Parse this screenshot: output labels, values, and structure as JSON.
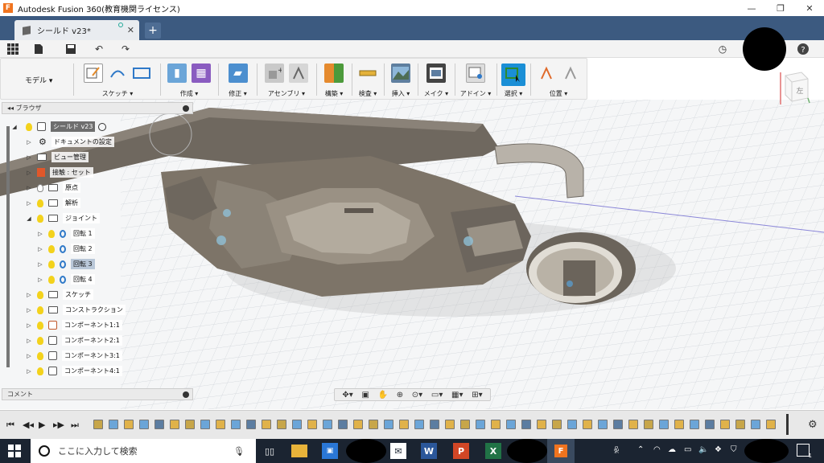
{
  "window": {
    "app_logo_letter": "F",
    "title": "Autodesk Fusion 360(教育機関ライセンス)",
    "minimize": "—",
    "maximize": "❐",
    "close": "✕"
  },
  "tabs": {
    "doc_tab_label": "シールド v23*",
    "close": "✕",
    "new": "+"
  },
  "ribbon": {
    "workspace": "モデル ▾",
    "groups": [
      {
        "label": "スケッチ ▾"
      },
      {
        "label": "作成 ▾"
      },
      {
        "label": "修正 ▾"
      },
      {
        "label": "アセンブリ ▾"
      },
      {
        "label": "構築 ▾"
      },
      {
        "label": "検査 ▾"
      },
      {
        "label": "挿入 ▾"
      },
      {
        "label": "メイク ▾"
      },
      {
        "label": "アドイン ▾"
      },
      {
        "label": "選択 ▾"
      },
      {
        "label": "位置 ▾"
      }
    ]
  },
  "browser": {
    "header": "ブラウザ",
    "root": "シールド v23",
    "items": [
      {
        "label": "ドキュメントの設定"
      },
      {
        "label": "ビュー管理"
      },
      {
        "label": "接触 : セット"
      },
      {
        "label": "原点"
      },
      {
        "label": "解析"
      },
      {
        "label": "ジョイント"
      },
      {
        "label": "回転 1"
      },
      {
        "label": "回転 2"
      },
      {
        "label": "回転 3"
      },
      {
        "label": "回転 4"
      },
      {
        "label": "スケッチ"
      },
      {
        "label": "コンストラクション"
      },
      {
        "label": "コンポーネント1:1"
      },
      {
        "label": "コンポーネント2:1"
      },
      {
        "label": "コンポーネント3:1"
      },
      {
        "label": "コンポーネント4:1"
      }
    ]
  },
  "comments": {
    "label": "コメント"
  },
  "viewcube": {
    "face_label": "左"
  },
  "taskbar": {
    "search_placeholder": "ここに入力して検索",
    "notification_count": "1"
  },
  "colors": {
    "tab_bar": "#3c5a80",
    "accent_select": "#1b8fd6",
    "taskbar": "#1b2431",
    "part_body": "#7d7468"
  }
}
